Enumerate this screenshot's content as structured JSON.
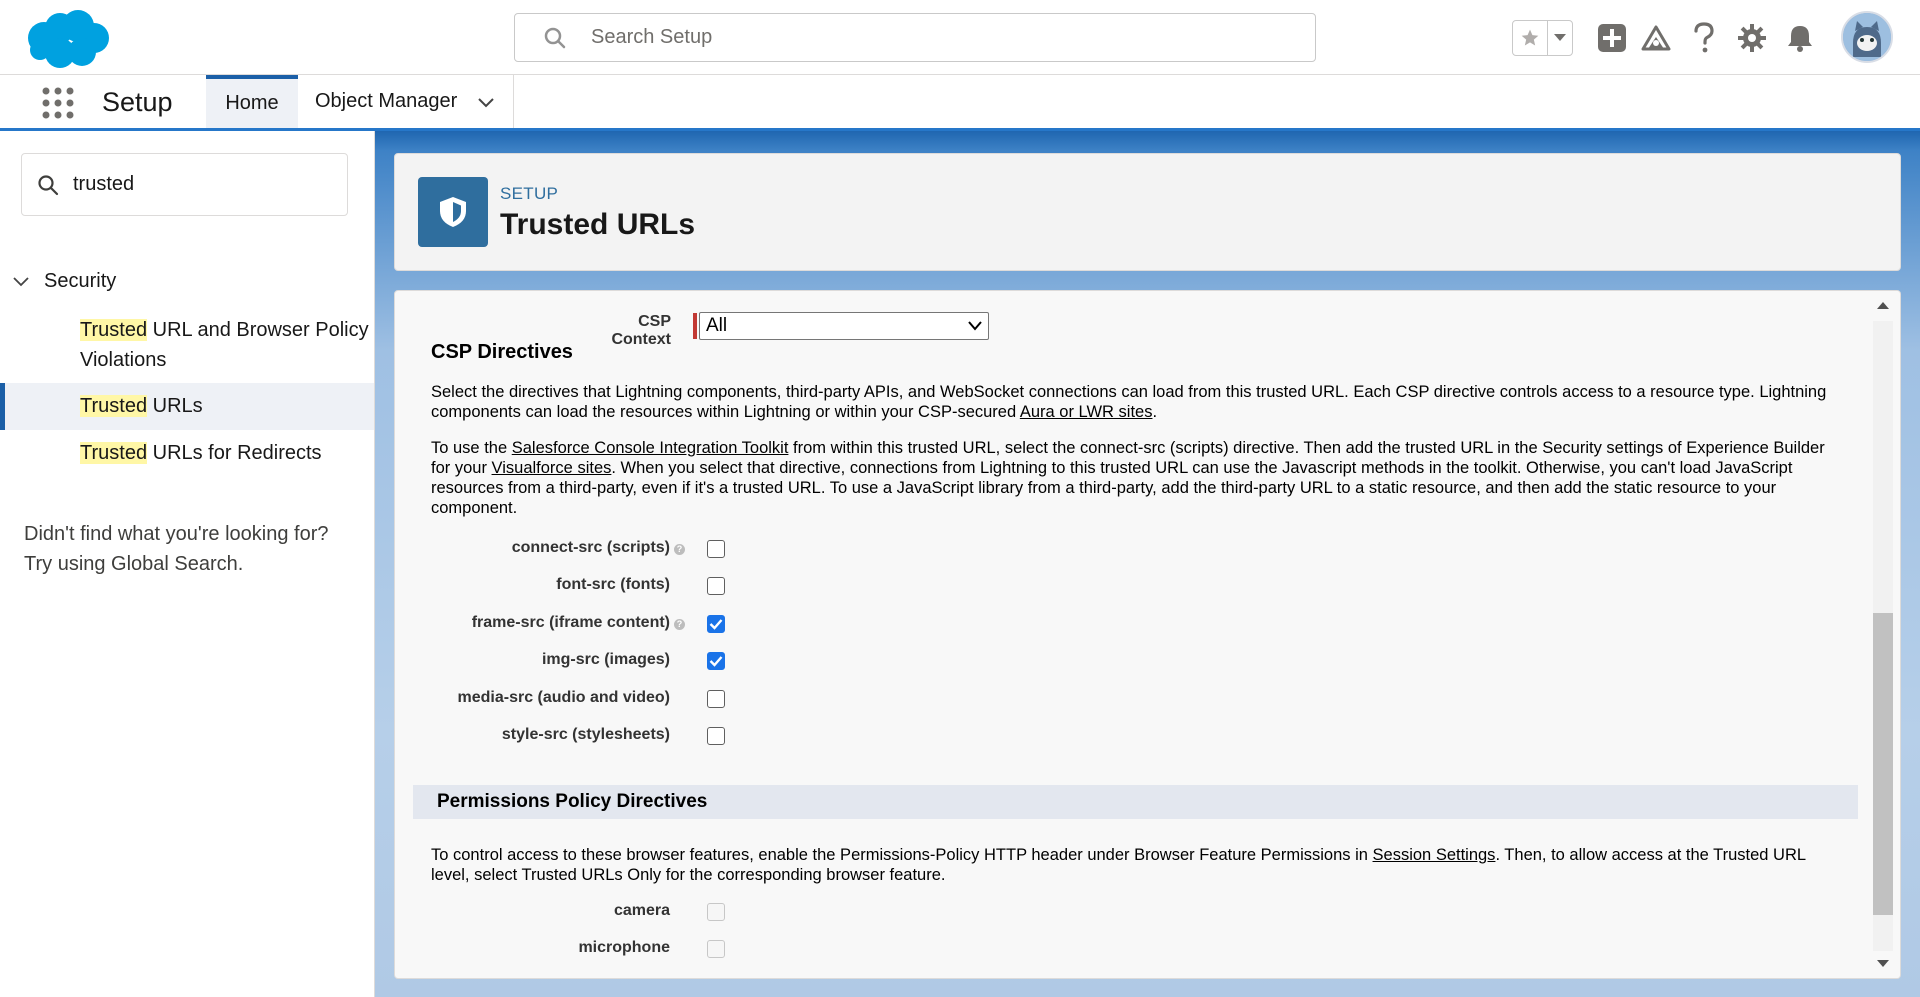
{
  "header": {
    "search_placeholder": "Search Setup",
    "brand_color": "#00a1e0"
  },
  "context_bar": {
    "app_name": "Setup",
    "tabs": [
      {
        "label": "Home",
        "active": true
      },
      {
        "label": "Object Manager",
        "active": false
      }
    ]
  },
  "sidebar": {
    "quick_find_value": "trusted",
    "tree": {
      "header": "Security",
      "items": [
        {
          "highlight": "Trusted",
          "rest": " URL and Browser Policy",
          "rest2": "Violations"
        },
        {
          "highlight": "Trusted",
          "rest": " URLs",
          "active": true
        },
        {
          "highlight": "Trusted",
          "rest": " URLs for Redirects"
        }
      ]
    },
    "no_result_line1": "Didn't find what you're looking for?",
    "no_result_line2": "Try using Global Search."
  },
  "page_header": {
    "breadcrumb": "SETUP",
    "title": "Trusted URLs"
  },
  "form": {
    "csp_context_label": "CSP Context",
    "csp_context_value": "All",
    "csp_section_title": "CSP Directives",
    "csp_para1_a": "Select the directives that Lightning components, third-party APIs, and WebSocket connections can load from this trusted URL. Each CSP directive controls access to a resource type. Lightning components can load the resources within Lightning or within your CSP-secured ",
    "csp_para1_link": "Aura or LWR sites",
    "csp_para1_b": ".",
    "csp_para2_a": "To use the ",
    "csp_para2_link1": "Salesforce Console Integration Toolkit",
    "csp_para2_b": " from within this trusted URL, select the connect-src (scripts) directive. Then add the trusted URL in the Security settings of Experience Builder for your ",
    "csp_para2_link2": "Visualforce sites",
    "csp_para2_c": ". When you select that directive, connections from Lightning to this trusted URL can use the Javascript methods in the toolkit. Otherwise, you can't load JavaScript resources from a third-party, even if it's a trusted URL. To use a JavaScript library from a third-party, add the third-party URL to a static resource, and then add the static resource to your component.",
    "csp_directives": [
      {
        "label": "connect-src (scripts)",
        "checked": false,
        "help": true
      },
      {
        "label": "font-src (fonts)",
        "checked": false,
        "help": false
      },
      {
        "label": "frame-src (iframe content)",
        "checked": true,
        "help": true
      },
      {
        "label": "img-src (images)",
        "checked": true,
        "help": false
      },
      {
        "label": "media-src (audio and video)",
        "checked": false,
        "help": false
      },
      {
        "label": "style-src (stylesheets)",
        "checked": false,
        "help": false
      }
    ],
    "perm_section_title": "Permissions Policy Directives",
    "perm_para_a": "To control access to these browser features, enable the Permissions-Policy HTTP header under Browser Feature Permissions in ",
    "perm_para_link": "Session Settings",
    "perm_para_b": ". Then, to allow access at the Trusted URL level, select Trusted URLs Only for the corresponding browser feature.",
    "perm_directives": [
      {
        "label": "camera",
        "checked": false,
        "disabled": true
      },
      {
        "label": "microphone",
        "checked": false,
        "disabled": true
      }
    ]
  },
  "icons": [
    "salesforce-cloud-logo",
    "search-icon",
    "star-icon",
    "chevron-down-icon",
    "plus-icon",
    "trailhead-icon",
    "help-icon",
    "gear-icon",
    "bell-icon",
    "avatar",
    "app-launcher-icon",
    "shield-icon"
  ]
}
